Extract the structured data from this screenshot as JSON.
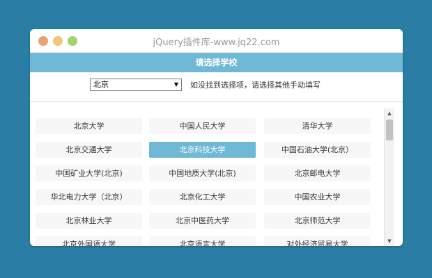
{
  "window": {
    "title": "jQuery插件库-www.jq22.com"
  },
  "header": {
    "title": "请选择学校"
  },
  "selector": {
    "selected": "北京",
    "hint": "如没找到选择项，请选择其他手动填写"
  },
  "schools": [
    "北京大学",
    "中国人民大学",
    "清华大学",
    "北京交通大学",
    "北京科技大学",
    "中国石油大学(北京）",
    "中国矿业大学(北京)",
    "中国地质大学(北京)",
    "北京邮电大学",
    "华北电力大学（北京）",
    "北京化工大学",
    "中国农业大学",
    "北京林业大学",
    "北京中医药大学",
    "北京师范大学",
    "北京外国语大学",
    "北京语言大学",
    "对外经济贸易大学"
  ],
  "selected_index": 4,
  "colors": {
    "background": "#2a7ea5",
    "accent": "#6fb8d6"
  }
}
